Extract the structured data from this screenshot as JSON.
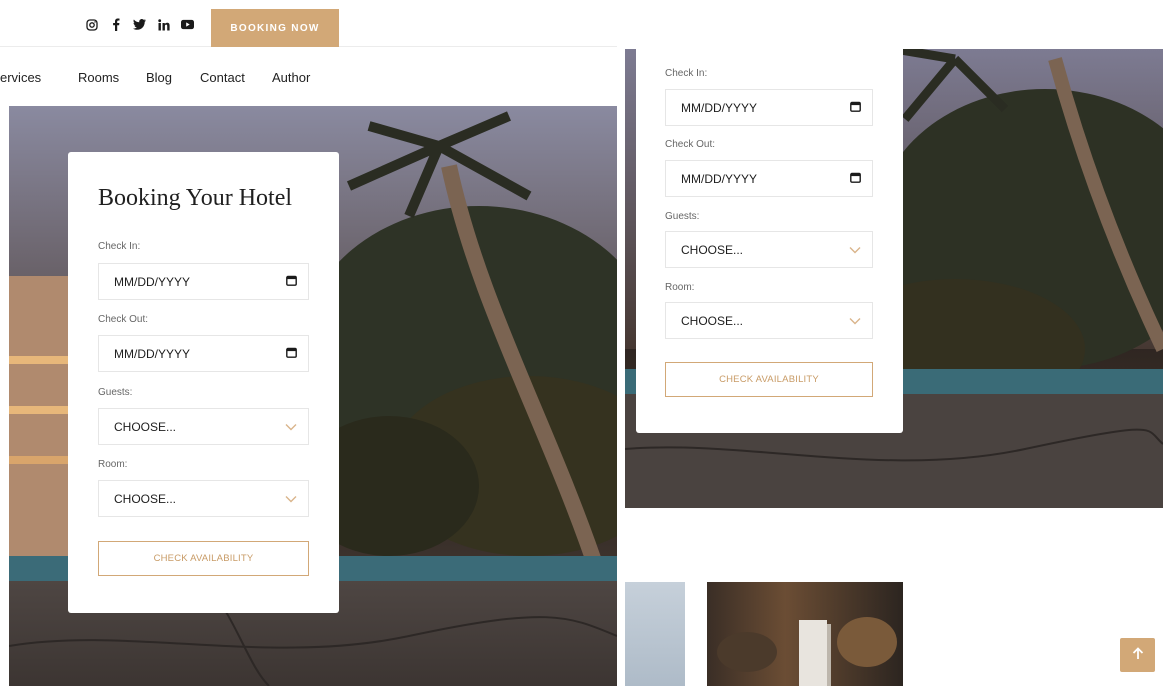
{
  "header": {
    "booking_button": "BOOKING NOW",
    "social_icons": [
      "instagram-icon",
      "facebook-icon",
      "twitter-icon",
      "linkedin-icon",
      "youtube-icon"
    ]
  },
  "nav": {
    "items": [
      "Services",
      "Rooms",
      "Blog",
      "Contact",
      "Author"
    ],
    "visible_first": "ervices"
  },
  "booking": {
    "title": "Booking Your Hotel",
    "check_in_label": "Check In:",
    "check_in_value": "MM/DD/YYYY",
    "check_out_label": "Check Out:",
    "check_out_value": "MM/DD/YYYY",
    "guests_label": "Guests:",
    "guests_value": "CHOOSE...",
    "room_label": "Room:",
    "room_value": "CHOOSE...",
    "button": "CHECK AVAILABILITY"
  },
  "colors": {
    "accent": "#d2a877",
    "accent_text": "#c89b66",
    "chevron": "#d9b48a"
  }
}
